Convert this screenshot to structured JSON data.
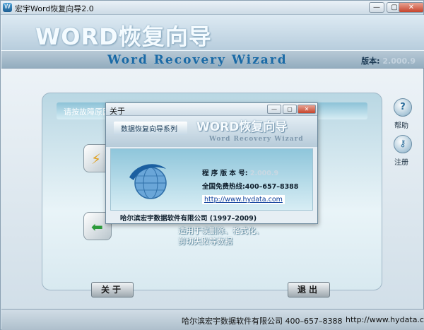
{
  "window": {
    "title": "宏宇Word恢复向导2.0",
    "app_icon_glyph": "W",
    "min_icon": "—",
    "max_icon": "▢",
    "close_icon": "✕"
  },
  "header": {
    "big_title": "WORD恢复向导",
    "subtitle": "Word Recovery Wizard",
    "version_label": "版本:",
    "version_value": "2.000.9"
  },
  "panel": {
    "prompt": "请按故障原因",
    "desc_line1": "适用于误删除、格式化、",
    "desc_line2": "剪切失败等数据"
  },
  "side": {
    "help_label": "帮助",
    "register_label": "注册",
    "help_glyph": "?",
    "register_glyph": "⚷"
  },
  "buttons": {
    "about": "关于",
    "exit": "退出"
  },
  "footer": {
    "company_phone": "哈尔滨宏宇数据软件有限公司  400–657–8388",
    "url": "http://www.hydata.com"
  },
  "about_dialog": {
    "title": "关于",
    "series": "数据恢复向导系列",
    "big_title": "WORD恢复向导",
    "subtitle": "Word Recovery Wizard",
    "version_label": "程 序 版 本 号:",
    "version_value": "2.000.9",
    "hotline": "全国免费热线:400–657–8388",
    "link": "http://www.hydata.com",
    "copyright": "哈尔滨宏宇数据软件有限公司 (1997–2009)"
  },
  "colors": {
    "accent": "#1a6aa6",
    "dialog_body": "#8fc6db"
  }
}
